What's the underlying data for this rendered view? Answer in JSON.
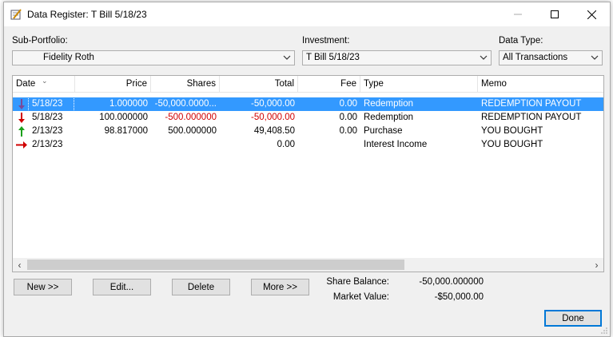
{
  "window": {
    "title": "Data Register: T Bill 5/18/23"
  },
  "filters": {
    "sub_portfolio": {
      "label": "Sub-Portfolio:",
      "value": "Fidelity Roth"
    },
    "investment": {
      "label": "Investment:",
      "value": "T Bill 5/18/23"
    },
    "data_type": {
      "label": "Data Type:",
      "value": "All Transactions"
    }
  },
  "table": {
    "columns": [
      "Date",
      "Price",
      "Shares",
      "Total",
      "Fee",
      "Type",
      "Memo"
    ],
    "rows": [
      {
        "icon": "purple-down-arrow-icon",
        "date": "5/18/23",
        "price": "1.000000",
        "shares": "-50,000.0000...",
        "total": "-50,000.00",
        "fee": "0.00",
        "type": "Redemption",
        "memo": "REDEMPTION PAYOUT"
      },
      {
        "icon": "red-down-arrow-icon",
        "date": "5/18/23",
        "price": "100.000000",
        "shares": "-500.000000",
        "total": "-50,000.00",
        "fee": "0.00",
        "type": "Redemption",
        "memo": "REDEMPTION PAYOUT"
      },
      {
        "icon": "green-up-arrow-icon",
        "date": "2/13/23",
        "price": "98.817000",
        "shares": "500.000000",
        "total": "49,408.50",
        "fee": "0.00",
        "type": "Purchase",
        "memo": "YOU BOUGHT"
      },
      {
        "icon": "red-right-arrow-icon",
        "date": "2/13/23",
        "price": "",
        "shares": "",
        "total": "0.00",
        "fee": "",
        "type": "Interest Income",
        "memo": "YOU BOUGHT"
      }
    ]
  },
  "buttons": {
    "new": "New >>",
    "edit": "Edit...",
    "delete": "Delete",
    "more": "More >>",
    "done": "Done"
  },
  "summary": {
    "share_balance_label": "Share Balance:",
    "share_balance_value": "-50,000.000000",
    "market_value_label": "Market Value:",
    "market_value_value": "-$50,000.00"
  },
  "colors": {
    "selection": "#3399ff",
    "negative": "#d00000",
    "accent": "#0078d7"
  }
}
